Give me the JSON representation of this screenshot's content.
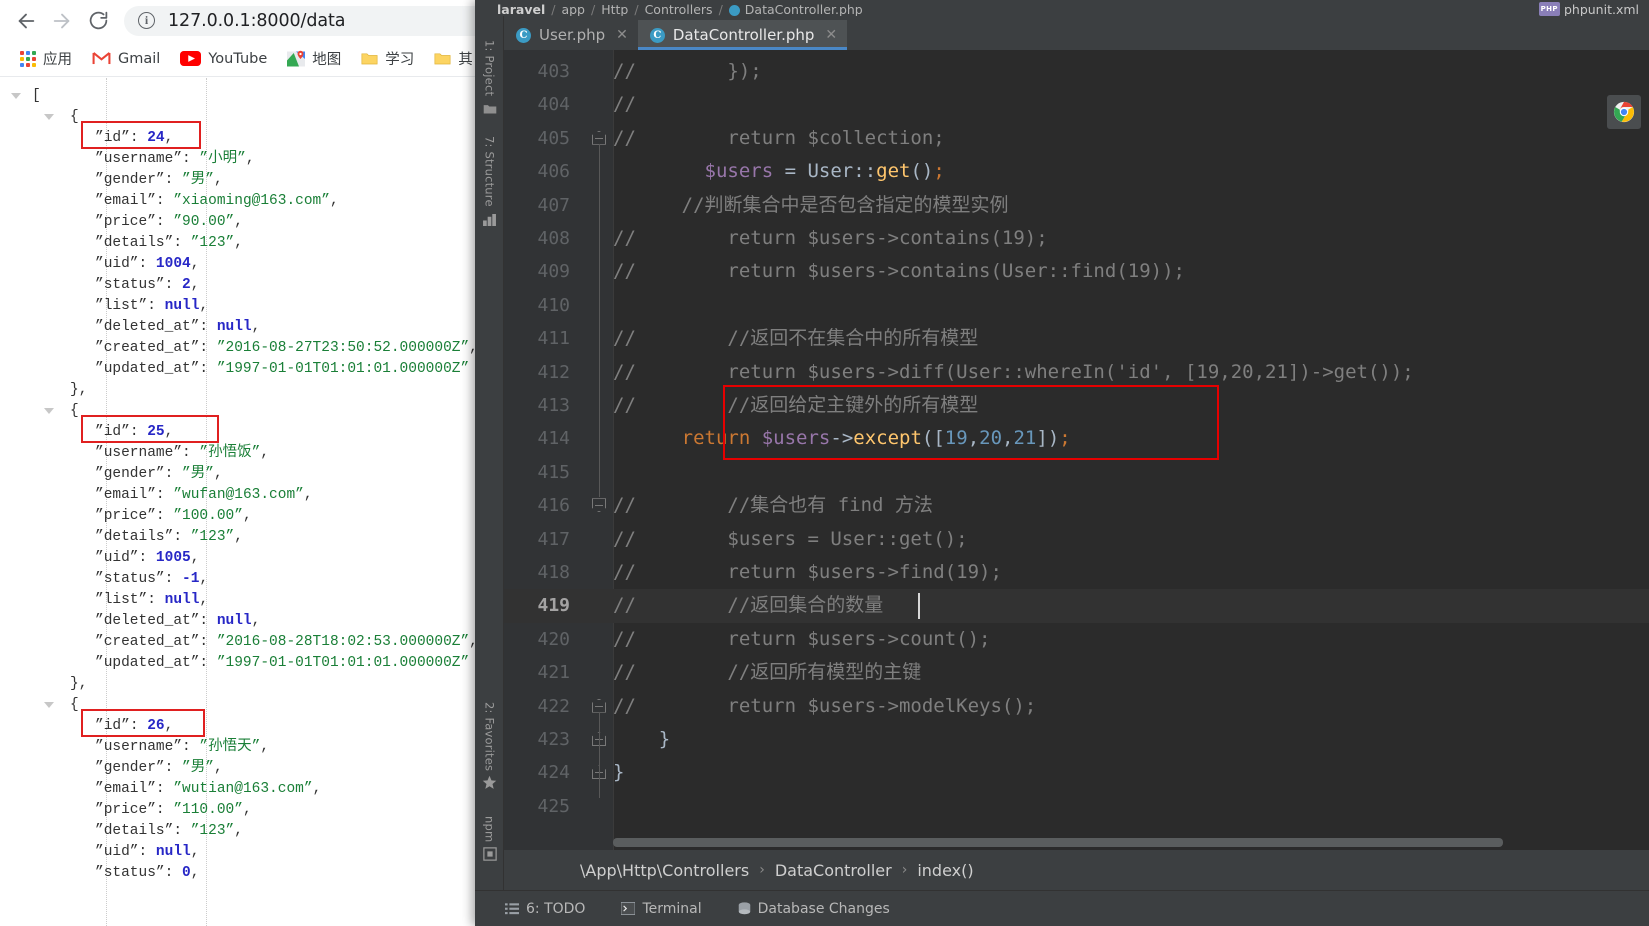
{
  "browser": {
    "nav": {
      "back_icon": "arrow-left-icon",
      "forward_icon": "arrow-right-icon",
      "reload_icon": "reload-icon"
    },
    "omnibox": {
      "info_icon": "info-circle-icon",
      "url": "127.0.0.1:8000/data"
    },
    "bookmarks": [
      {
        "label": "应用",
        "icon": "apps-grid-icon"
      },
      {
        "label": "Gmail",
        "icon": "gmail-icon"
      },
      {
        "label": "YouTube",
        "icon": "youtube-icon"
      },
      {
        "label": "地图",
        "icon": "maps-icon"
      },
      {
        "label": "学习",
        "icon": "folder-icon"
      },
      {
        "label": "其",
        "icon": "folder-icon"
      }
    ]
  },
  "json_viewer": {
    "open_bracket": "[",
    "records": [
      {
        "id_label": "\"id\"",
        "id_value": "24",
        "fields": [
          {
            "key": "\"username\"",
            "value": "\"小明\"",
            "type": "string"
          },
          {
            "key": "\"gender\"",
            "value": "\"男\"",
            "type": "string"
          },
          {
            "key": "\"email\"",
            "value": "\"xiaoming@163.com\"",
            "type": "string"
          },
          {
            "key": "\"price\"",
            "value": "\"90.00\"",
            "type": "string"
          },
          {
            "key": "\"details\"",
            "value": "\"123\"",
            "type": "string"
          },
          {
            "key": "\"uid\"",
            "value": "1004",
            "type": "number"
          },
          {
            "key": "\"status\"",
            "value": "2",
            "type": "number"
          },
          {
            "key": "\"list\"",
            "value": "null",
            "type": "null"
          },
          {
            "key": "\"deleted_at\"",
            "value": "null",
            "type": "null"
          },
          {
            "key": "\"created_at\"",
            "value": "\"2016-08-27T23:50:52.000000Z\"",
            "type": "string"
          },
          {
            "key": "\"updated_at\"",
            "value": "\"1997-01-01T01:01:01.000000Z\"",
            "type": "string",
            "last": true
          }
        ]
      },
      {
        "id_label": "\"id\"",
        "id_value": "25",
        "fields": [
          {
            "key": "\"username\"",
            "value": "\"孙悟饭\"",
            "type": "string"
          },
          {
            "key": "\"gender\"",
            "value": "\"男\"",
            "type": "string"
          },
          {
            "key": "\"email\"",
            "value": "\"wufan@163.com\"",
            "type": "string"
          },
          {
            "key": "\"price\"",
            "value": "\"100.00\"",
            "type": "string"
          },
          {
            "key": "\"details\"",
            "value": "\"123\"",
            "type": "string"
          },
          {
            "key": "\"uid\"",
            "value": "1005",
            "type": "number"
          },
          {
            "key": "\"status\"",
            "value": "-1",
            "type": "number"
          },
          {
            "key": "\"list\"",
            "value": "null",
            "type": "null"
          },
          {
            "key": "\"deleted_at\"",
            "value": "null",
            "type": "null"
          },
          {
            "key": "\"created_at\"",
            "value": "\"2016-08-28T18:02:53.000000Z\"",
            "type": "string"
          },
          {
            "key": "\"updated_at\"",
            "value": "\"1997-01-01T01:01:01.000000Z\"",
            "type": "string",
            "last": true
          }
        ]
      },
      {
        "id_label": "\"id\"",
        "id_value": "26",
        "fields": [
          {
            "key": "\"username\"",
            "value": "\"孙悟天\"",
            "type": "string"
          },
          {
            "key": "\"gender\"",
            "value": "\"男\"",
            "type": "string"
          },
          {
            "key": "\"email\"",
            "value": "\"wutian@163.com\"",
            "type": "string"
          },
          {
            "key": "\"price\"",
            "value": "\"110.00\"",
            "type": "string"
          },
          {
            "key": "\"details\"",
            "value": "\"123\"",
            "type": "string"
          },
          {
            "key": "\"uid\"",
            "value": "null",
            "type": "null"
          },
          {
            "key": "\"status\"",
            "value": "0",
            "type": "number"
          }
        ]
      }
    ]
  },
  "ide": {
    "breadcrumb": {
      "project": "laravel",
      "parts": [
        "app",
        "Http",
        "Controllers"
      ],
      "file": "DataController.php"
    },
    "right_file": {
      "badge": "PHP",
      "label": "phpunit.xml"
    },
    "tabs": [
      {
        "label": "User.php",
        "icon": "php-class-icon",
        "close_icon": "close-icon",
        "active": false
      },
      {
        "label": "DataController.php",
        "icon": "php-class-icon",
        "close_icon": "close-icon",
        "active": true
      }
    ],
    "tool_windows_left": [
      {
        "label": "1: Project",
        "icon": "folder-icon"
      },
      {
        "label": "7: Structure",
        "icon": "structure-icon"
      },
      {
        "label": "2: Favorites",
        "icon": "star-icon"
      },
      {
        "label": "npm",
        "icon": "npm-icon"
      }
    ],
    "editor": {
      "first_line": 403,
      "caret_line": 419,
      "lines": [
        {
          "n": 403,
          "segments": [
            {
              "t": "//        });",
              "c": "cmt"
            }
          ]
        },
        {
          "n": 404,
          "segments": [
            {
              "t": "//",
              "c": "cmt"
            }
          ]
        },
        {
          "n": 405,
          "fold": "top",
          "segments": [
            {
              "t": "//        return $collection;",
              "c": "cmt"
            }
          ]
        },
        {
          "n": 406,
          "segments": [
            {
              "t": "        ",
              "c": "pln"
            },
            {
              "t": "$users",
              "c": "var"
            },
            {
              "t": " = ",
              "c": "pln"
            },
            {
              "t": "User",
              "c": "pln"
            },
            {
              "t": "::",
              "c": "pln"
            },
            {
              "t": "get",
              "c": "fn"
            },
            {
              "t": "()",
              "c": "pln"
            },
            {
              "t": ";",
              "c": "semi"
            }
          ]
        },
        {
          "n": 407,
          "segments": [
            {
              "t": "      //判断集合中是否包含指定的模型实例",
              "c": "cmt"
            }
          ]
        },
        {
          "n": 408,
          "segments": [
            {
              "t": "//        return $users->contains(19);",
              "c": "cmt"
            }
          ]
        },
        {
          "n": 409,
          "segments": [
            {
              "t": "//        return $users->contains(User::find(19));",
              "c": "cmt"
            }
          ]
        },
        {
          "n": 410,
          "segments": []
        },
        {
          "n": 411,
          "segments": [
            {
              "t": "//        //返回不在集合中的所有模型",
              "c": "cmt"
            }
          ]
        },
        {
          "n": 412,
          "segments": [
            {
              "t": "//        return $users->diff(User::whereIn('id', [19,20,21])->get());",
              "c": "cmt"
            }
          ]
        },
        {
          "n": 413,
          "segments": [
            {
              "t": "//        //返回给定主键外的所有模型",
              "c": "cmt"
            }
          ]
        },
        {
          "n": 414,
          "segments": [
            {
              "t": "      ",
              "c": "pln"
            },
            {
              "t": "return",
              "c": "kw"
            },
            {
              "t": " ",
              "c": "pln"
            },
            {
              "t": "$users",
              "c": "var"
            },
            {
              "t": "->",
              "c": "pln"
            },
            {
              "t": "except",
              "c": "fn"
            },
            {
              "t": "([",
              "c": "pln"
            },
            {
              "t": "19",
              "c": "num"
            },
            {
              "t": ",",
              "c": "pln"
            },
            {
              "t": "20",
              "c": "num"
            },
            {
              "t": ",",
              "c": "pln"
            },
            {
              "t": "21",
              "c": "num"
            },
            {
              "t": "])",
              "c": "pln"
            },
            {
              "t": ";",
              "c": "semi"
            }
          ]
        },
        {
          "n": 415,
          "segments": []
        },
        {
          "n": 416,
          "fold": "bottom",
          "segments": [
            {
              "t": "//        //集合也有 find 方法",
              "c": "cmt"
            }
          ]
        },
        {
          "n": 417,
          "segments": [
            {
              "t": "//        $users = User::get();",
              "c": "cmt"
            }
          ]
        },
        {
          "n": 418,
          "segments": [
            {
              "t": "//        return $users->find(19);",
              "c": "cmt"
            }
          ]
        },
        {
          "n": 419,
          "segments": [
            {
              "t": "//        //返回集合的数量",
              "c": "cmt"
            }
          ]
        },
        {
          "n": 420,
          "segments": [
            {
              "t": "//        return $users->count();",
              "c": "cmt"
            }
          ]
        },
        {
          "n": 421,
          "segments": [
            {
              "t": "//        //返回所有模型的主键",
              "c": "cmt"
            }
          ]
        },
        {
          "n": 422,
          "fold": "top",
          "segments": [
            {
              "t": "//        return $users->modelKeys();",
              "c": "cmt"
            }
          ]
        },
        {
          "n": 423,
          "fold": "top",
          "segments": [
            {
              "t": "    }",
              "c": "pln"
            }
          ]
        },
        {
          "n": 424,
          "fold": "top",
          "segments": [
            {
              "t": "}",
              "c": "pln"
            }
          ]
        },
        {
          "n": 425,
          "segments": []
        }
      ]
    },
    "structure_breadcrumb": {
      "namespace": "\\App\\Http\\Controllers",
      "class": "DataController",
      "method": "index()",
      "separator": "›"
    },
    "status_bar": [
      {
        "label": "6: TODO",
        "icon": "todo-icon"
      },
      {
        "label": "Terminal",
        "icon": "terminal-icon"
      },
      {
        "label": "Database Changes",
        "icon": "database-icon"
      }
    ],
    "chrome_button": {
      "icon": "chrome-icon"
    }
  }
}
